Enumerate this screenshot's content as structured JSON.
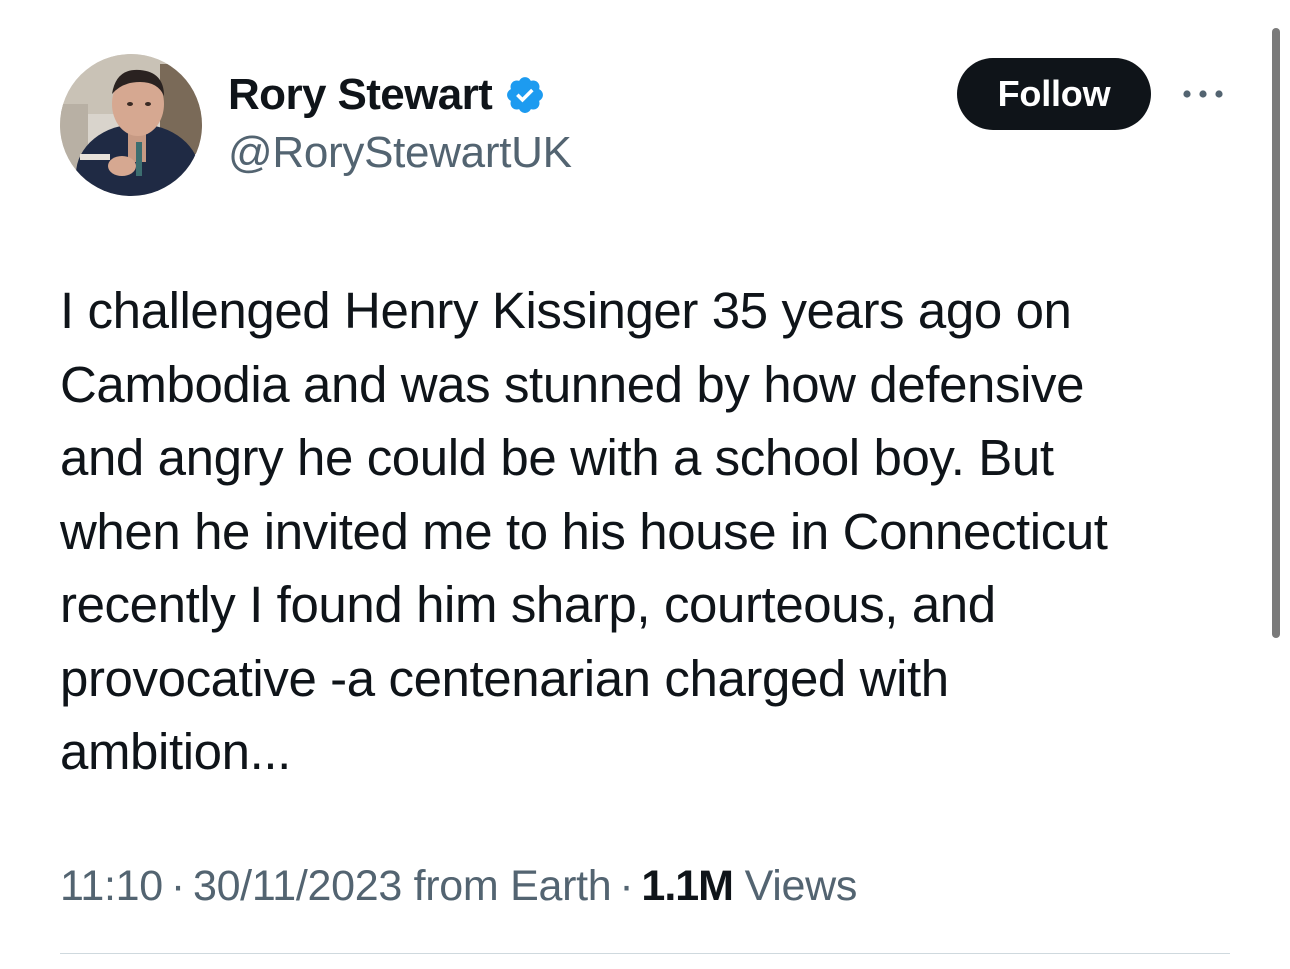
{
  "tweet": {
    "author": {
      "display_name": "Rory Stewart",
      "handle": "@RoryStewartUK",
      "verified_icon": "verified-badge-icon",
      "avatar_icon": "avatar-photo"
    },
    "follow_label": "Follow",
    "more_icon": "more-options-icon",
    "text": "I challenged Henry Kissinger 35 years ago on\nCambodia and was stunned by how defensive\nand angry he could be with a school boy. But\nwhen he invited me to his house in Connecticut\nrecently I found him sharp, courteous, and\nprovocative -a centenarian charged with\nambition...",
    "time": "11:10",
    "date": "30/11/2023",
    "source": "from Earth",
    "views_count": "1.1M",
    "views_label": "Views",
    "separator": "·"
  },
  "colors": {
    "text_primary": "#0f1419",
    "text_secondary": "#536471",
    "verified_blue": "#1d9bf0",
    "follow_bg": "#0f1419",
    "follow_text": "#ffffff",
    "divider": "#cfd9de"
  }
}
